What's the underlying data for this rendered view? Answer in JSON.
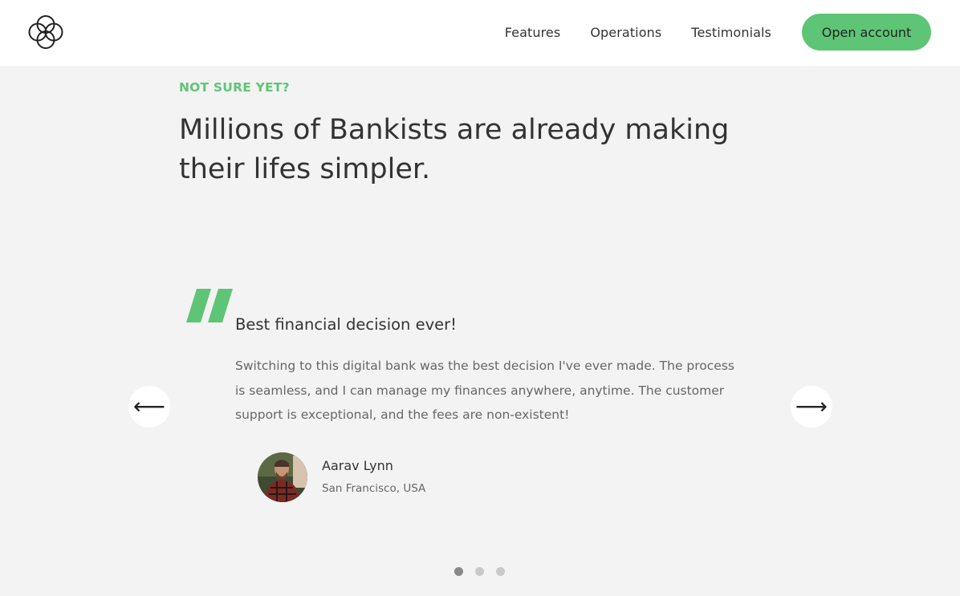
{
  "nav": {
    "logo_icon": "bankist-logo-icon",
    "links": [
      {
        "label": "Features"
      },
      {
        "label": "Operations"
      },
      {
        "label": "Testimonials"
      }
    ],
    "cta_label": "Open account"
  },
  "section": {
    "tag": "NOT SURE YET?",
    "title": "Millions of Bankists are already making their lifes simpler."
  },
  "testimonial": {
    "quote_icon": "quote-mark-icon",
    "heading": "Best financial decision ever!",
    "text": "Switching to this digital bank was the best decision I've ever made. The process is seamless, and I can manage my finances anywhere, anytime. The customer support is exceptional, and the fees are non-existent!",
    "author_name": "Aarav Lynn",
    "author_location": "San Francisco, USA"
  },
  "slider": {
    "prev_icon": "arrow-left-icon",
    "next_icon": "arrow-right-icon",
    "prev_glyph": "⟵",
    "next_glyph": "⟶",
    "active_slide": 1,
    "slide_count": 3
  },
  "colors": {
    "accent": "#5ec576",
    "background": "#f3f3f3",
    "header_bg": "#ffffff"
  }
}
